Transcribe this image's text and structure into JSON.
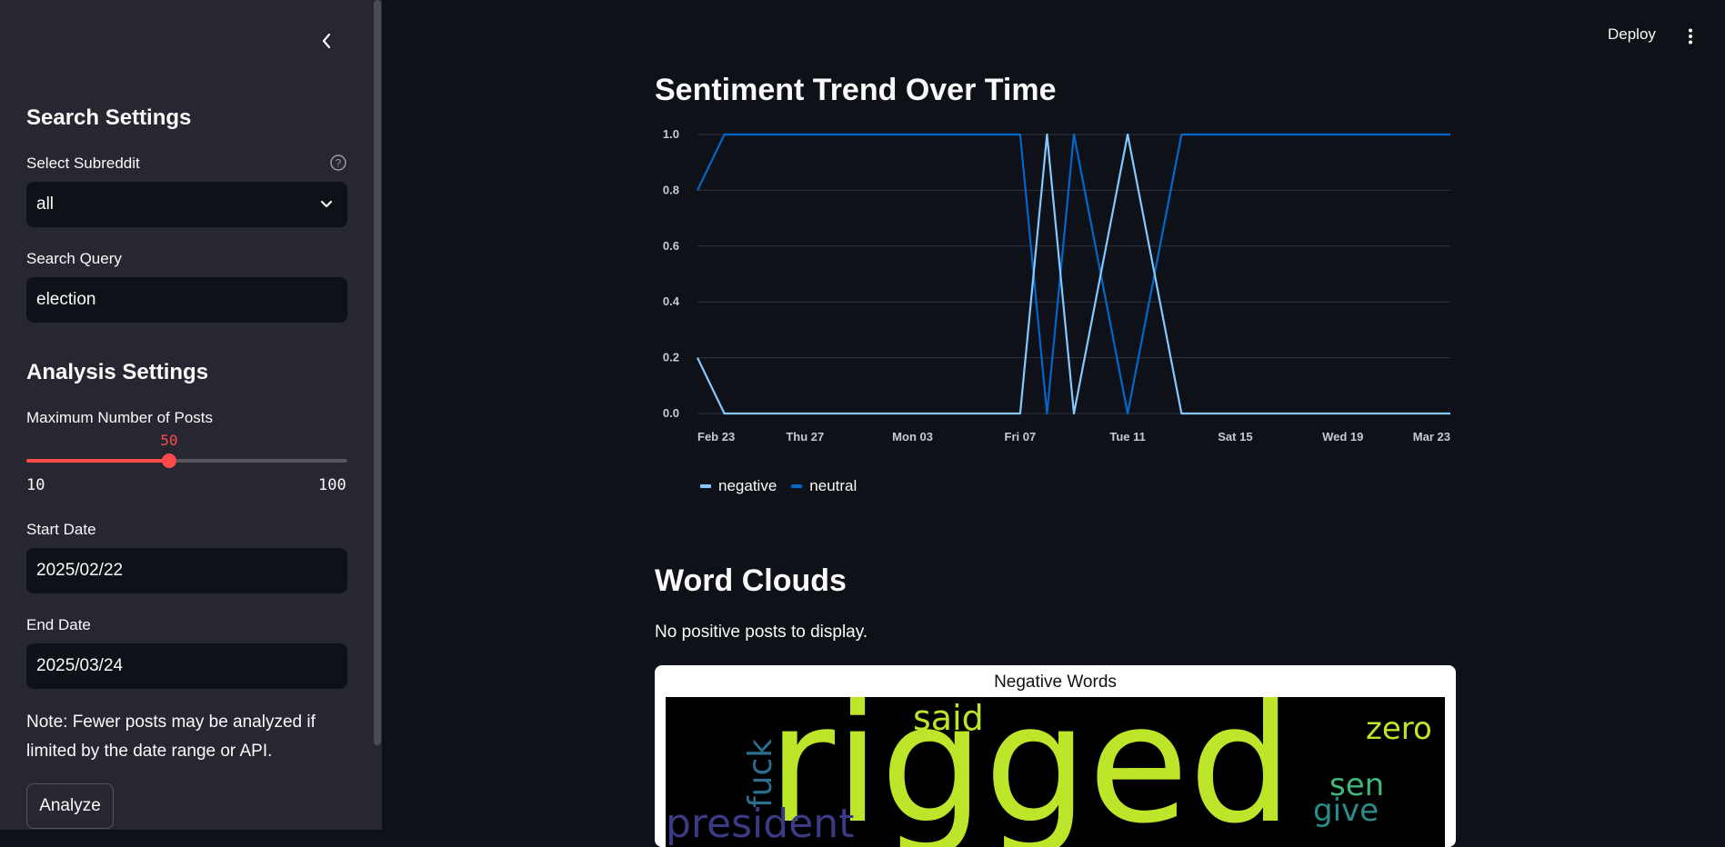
{
  "sidebar": {
    "collapse_icon": "chevron-left-icon",
    "search_settings_heading": "Search Settings",
    "subreddit_label": "Select Subreddit",
    "subreddit_value": "all",
    "query_label": "Search Query",
    "query_value": "election",
    "analysis_settings_heading": "Analysis Settings",
    "max_posts_label": "Maximum Number of Posts",
    "max_posts_value": "50",
    "max_posts_min": "10",
    "max_posts_max": "100",
    "start_date_label": "Start Date",
    "start_date_value": "2025/02/22",
    "end_date_label": "End Date",
    "end_date_value": "2025/03/24",
    "note": "Note: Fewer posts may be analyzed if limited by the date range or API.",
    "analyze_label": "Analyze"
  },
  "header": {
    "deploy_label": "Deploy",
    "menu_icon": "more-vertical-icon"
  },
  "main": {
    "trend_heading": "Sentiment Trend Over Time",
    "wordclouds_heading": "Word Clouds",
    "no_positive_text": "No positive posts to display.",
    "negative_words_title": "Negative Words",
    "negative_words": [
      {
        "text": "rigged",
        "color": "#bde52a"
      },
      {
        "text": "said",
        "color": "#bde52a"
      },
      {
        "text": "zero",
        "color": "#bde52a"
      },
      {
        "text": "fuck",
        "color": "#2b6e8e"
      },
      {
        "text": "sen",
        "color": "#3fb87a"
      },
      {
        "text": "give",
        "color": "#2a8c8c"
      },
      {
        "text": "president",
        "color": "#3b3a84"
      }
    ]
  },
  "colors": {
    "accent": "#ff4b4b",
    "negative": "#83c9ff",
    "neutral": "#0068c9"
  },
  "chart_data": {
    "type": "line",
    "title": "Sentiment Trend Over Time",
    "xlabel": "",
    "ylabel": "",
    "x_ticks": [
      "Feb 23",
      "Thu 27",
      "Mon 03",
      "Fri 07",
      "Tue 11",
      "Sat 15",
      "Wed 19",
      "Mar 23"
    ],
    "ylim": [
      0,
      1
    ],
    "y_ticks": [
      "0.0",
      "0.2",
      "0.4",
      "0.6",
      "0.8",
      "1.0"
    ],
    "grid": true,
    "legend": "bottom-left",
    "series": [
      {
        "name": "negative",
        "color": "#83c9ff",
        "x": [
          "2025-02-23",
          "2025-02-24",
          "2025-03-07",
          "2025-03-08",
          "2025-03-09",
          "2025-03-11",
          "2025-03-13",
          "2025-03-23"
        ],
        "y": [
          0.2,
          0,
          0,
          1,
          0,
          1,
          0,
          0
        ]
      },
      {
        "name": "neutral",
        "color": "#0068c9",
        "x": [
          "2025-02-23",
          "2025-02-24",
          "2025-03-07",
          "2025-03-08",
          "2025-03-09",
          "2025-03-11",
          "2025-03-13",
          "2025-03-23"
        ],
        "y": [
          0.8,
          1,
          1,
          0,
          1,
          0,
          1,
          1
        ]
      }
    ]
  }
}
